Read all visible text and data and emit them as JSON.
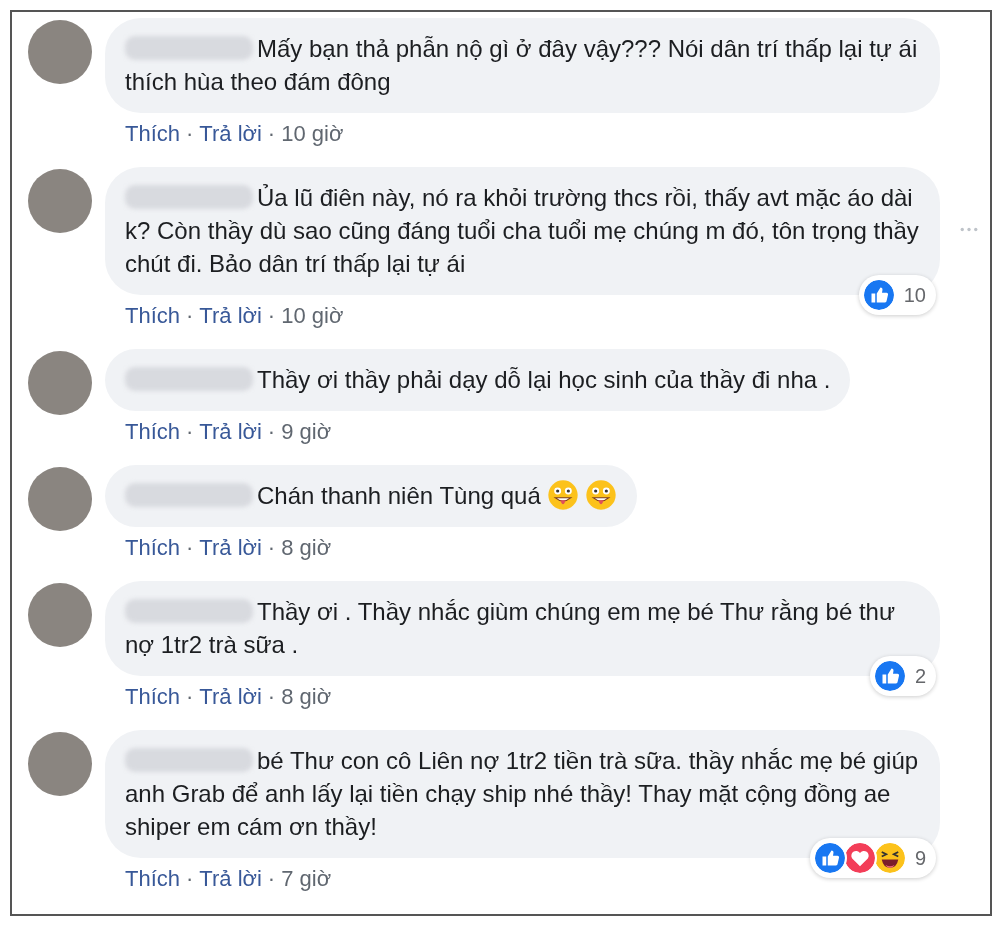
{
  "comments": [
    {
      "text": "Mấy bạn thả phẫn nộ gì ở đây vậy??? Nói dân trí thấp lại tự ái thích hùa theo đám đông",
      "actions": [
        {
          "kind": "link",
          "text": "Thích"
        },
        {
          "kind": "dot",
          "text": "·"
        },
        {
          "kind": "link",
          "text": "Trả lời"
        },
        {
          "kind": "dot",
          "text": "·"
        },
        {
          "kind": "time",
          "text": "10 giờ"
        }
      ]
    },
    {
      "text": "Ủa lũ điên này, nó ra khỏi trường thcs rồi, thấy avt mặc áo dài k? Còn thầy dù sao cũng đáng tuổi cha tuổi mẹ chúng m đó, tôn trọng thầy chút đi. Bảo dân trí thấp lại tự ái",
      "actions": [
        {
          "kind": "link",
          "text": "Thích"
        },
        {
          "kind": "dot",
          "text": "·"
        },
        {
          "kind": "link",
          "text": "Trả lời"
        },
        {
          "kind": "dot",
          "text": "·"
        },
        {
          "kind": "time",
          "text": "10 giờ"
        }
      ],
      "reactions": {
        "icons": [
          {
            "kind": "like"
          }
        ],
        "count": "10"
      },
      "more_menu": true
    },
    {
      "text": "Thầy ơi thầy phải dạy dỗ lại học sinh của thầy đi nha .",
      "actions": [
        {
          "kind": "link",
          "text": "Thích"
        },
        {
          "kind": "dot",
          "text": "·"
        },
        {
          "kind": "link",
          "text": "Trả lời"
        },
        {
          "kind": "dot",
          "text": "·"
        },
        {
          "kind": "time",
          "text": "9 giờ"
        }
      ]
    },
    {
      "text": "Chán thanh niên Tùng quá",
      "icons": [
        {
          "kind": "tongue-face"
        },
        {
          "kind": "tongue-face"
        }
      ],
      "actions": [
        {
          "kind": "link",
          "text": "Thích"
        },
        {
          "kind": "dot",
          "text": "·"
        },
        {
          "kind": "link",
          "text": "Trả lời"
        },
        {
          "kind": "dot",
          "text": "·"
        },
        {
          "kind": "time",
          "text": "8 giờ"
        }
      ]
    },
    {
      "text": "Thầy ơi . Thầy nhắc giùm chúng em mẹ bé Thư rằng bé thư nợ 1tr2 trà sữa .",
      "actions": [
        {
          "kind": "link",
          "text": "Thích"
        },
        {
          "kind": "dot",
          "text": "·"
        },
        {
          "kind": "link",
          "text": "Trả lời"
        },
        {
          "kind": "dot",
          "text": "·"
        },
        {
          "kind": "time",
          "text": "8 giờ"
        }
      ],
      "reactions": {
        "icons": [
          {
            "kind": "like"
          }
        ],
        "count": "2"
      }
    },
    {
      "text": "bé Thư con cô Liên nợ 1tr2 tiền trà sữa. thầy nhắc mẹ bé giúp anh Grab để anh lấy lại tiền chạy ship nhé thầy! Thay mặt cộng đồng ae shiper em cám ơn thầy!",
      "actions": [
        {
          "kind": "link",
          "text": "Thích"
        },
        {
          "kind": "dot",
          "text": "·"
        },
        {
          "kind": "link",
          "text": "Trả lời"
        },
        {
          "kind": "dot",
          "text": "·"
        },
        {
          "kind": "time",
          "text": "7 giờ"
        }
      ],
      "reactions": {
        "icons": [
          {
            "kind": "like"
          },
          {
            "kind": "love"
          },
          {
            "kind": "haha"
          }
        ],
        "count": "9"
      }
    }
  ]
}
